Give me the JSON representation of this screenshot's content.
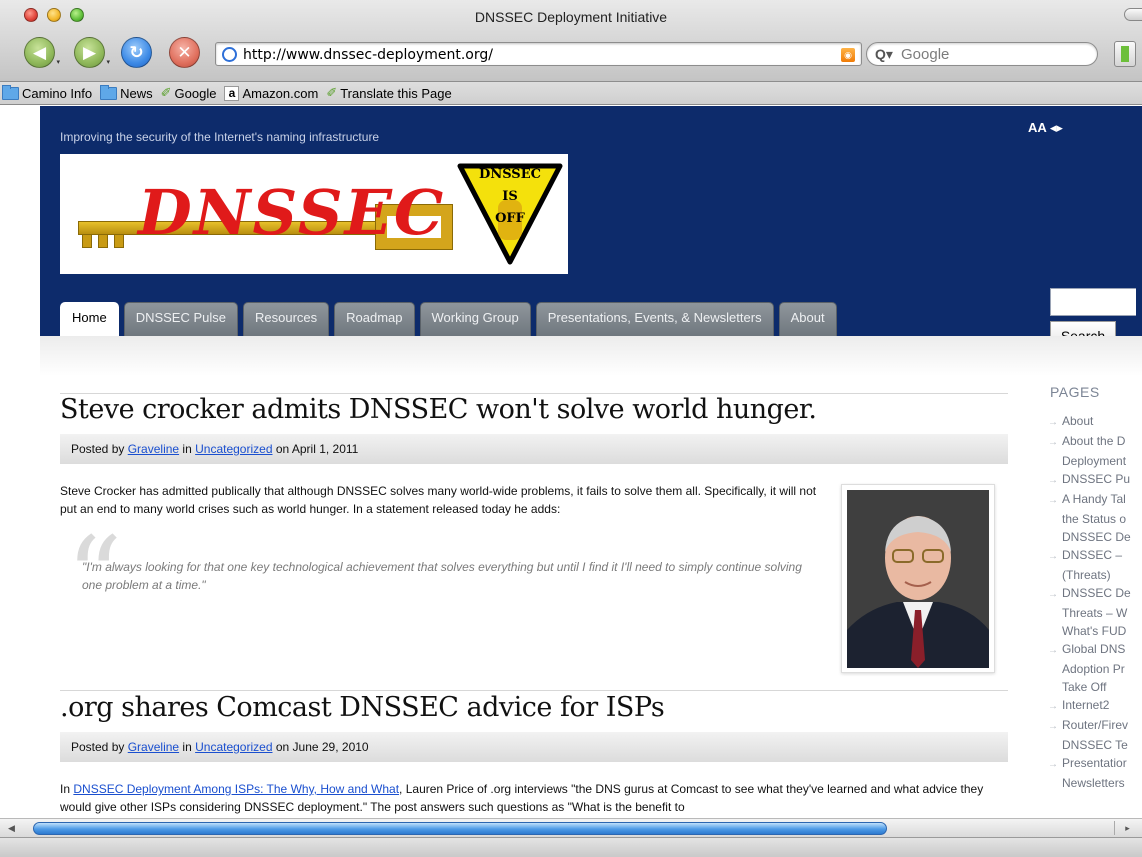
{
  "window": {
    "title": "DNSSEC Deployment Initiative"
  },
  "toolbar": {
    "url": "http://www.dnssec-deployment.org/",
    "search_placeholder": "Google",
    "search_prefix": "Q▾"
  },
  "bookmarks": [
    {
      "label": "Camino Info",
      "icon": "folder-icon"
    },
    {
      "label": "News",
      "icon": "folder-icon"
    },
    {
      "label": "Google",
      "icon": "bookmark-leaf-icon"
    },
    {
      "label": "Amazon.com",
      "icon": "amazon-icon"
    },
    {
      "label": "Translate this Page",
      "icon": "bookmark-leaf-icon"
    }
  ],
  "site": {
    "tagline": "Improving the security of the Internet's naming infrastructure",
    "font_tool": "AA ◂▸",
    "logo_word": "DNSSEC",
    "warning_lines": [
      "DNSSEC",
      "IS",
      "OFF"
    ],
    "header_color": "#0d2b6b"
  },
  "nav": {
    "tabs": [
      {
        "label": "Home",
        "active": true
      },
      {
        "label": "DNSSEC Pulse"
      },
      {
        "label": "Resources"
      },
      {
        "label": "Roadmap"
      },
      {
        "label": "Working Group"
      },
      {
        "label": "Presentations, Events, & Newsletters"
      },
      {
        "label": "About"
      }
    ]
  },
  "sidebar": {
    "search_button": "Search",
    "pages_heading": "PAGES",
    "pages_lines": [
      {
        "text": "About",
        "first": true
      },
      {
        "text": "About the D",
        "first": true
      },
      {
        "text": "Deployment",
        "first": false
      },
      {
        "text": "DNSSEC Pu",
        "first": true
      },
      {
        "text": "A Handy Tal",
        "first": true
      },
      {
        "text": "the Status o",
        "first": false
      },
      {
        "text": "DNSSEC De",
        "first": false
      },
      {
        "text": "DNSSEC –",
        "first": true
      },
      {
        "text": "(Threats)",
        "first": false
      },
      {
        "text": "DNSSEC De",
        "first": true
      },
      {
        "text": "Threats – W",
        "first": false
      },
      {
        "text": "What's FUD",
        "first": false
      },
      {
        "text": "Global DNS",
        "first": true
      },
      {
        "text": "Adoption Pr",
        "first": false
      },
      {
        "text": "Take Off",
        "first": false
      },
      {
        "text": "Internet2",
        "first": true
      },
      {
        "text": "Router/Firev",
        "first": true
      },
      {
        "text": "DNSSEC Te",
        "first": false
      },
      {
        "text": "Presentatior",
        "first": true
      },
      {
        "text": "Newsletters",
        "first": false
      }
    ]
  },
  "posts": [
    {
      "title": "Steve crocker admits DNSSEC won't solve world hunger.",
      "meta_prefix": "Posted by",
      "author": "Graveline",
      "meta_in": "in",
      "category": "Uncategorized",
      "meta_on": "on April 1, 2011",
      "body": "Steve Crocker has admitted publically that although DNSSEC solves many world-wide problems, it fails to solve them all. Specifically, it will not put an end to many world crises such as world hunger. In a statement released today he adds:",
      "quote": "\"I'm always looking for that one key technological achievement that solves everything but until I find it I'll need to simply continue solving one problem at a time.\""
    },
    {
      "title": ".org shares Comcast DNSSEC advice for ISPs",
      "meta_prefix": "Posted by",
      "author": "Graveline",
      "meta_in": "in",
      "category": "Uncategorized",
      "meta_on": "on June 29, 2010",
      "body_prefix": "In",
      "body_link": "DNSSEC Deployment Among ISPs: The Why, How and What",
      "body_rest": ", Lauren Price of .org interviews \"the DNS gurus at Comcast to see what they've learned and what advice they would give other ISPs considering DNSSEC deployment.\" The post answers such questions as \"What is the benefit to"
    }
  ]
}
